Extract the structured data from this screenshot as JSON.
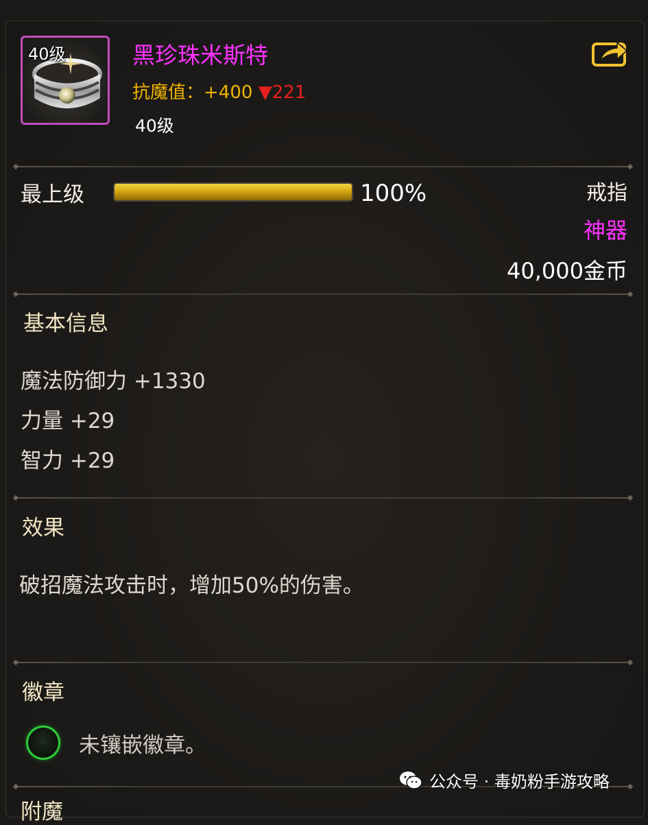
{
  "item": {
    "icon_level": "40级",
    "name": "黑珍珠米斯特",
    "anti_magic_label": "抗魔值：",
    "anti_magic_value": "+400",
    "anti_magic_diff": "▼221",
    "required_level": "40级"
  },
  "grade": {
    "label": "最上级",
    "percent_text": "100%",
    "fill_fraction": 1.0
  },
  "meta": {
    "type": "戒指",
    "rarity": "神器",
    "price": "40,000金币"
  },
  "basic_info": {
    "title": "基本信息",
    "stats": [
      "魔法防御力 +1330",
      "力量 +29",
      "智力 +29"
    ]
  },
  "effect": {
    "title": "效果",
    "text": "破招魔法攻击时，增加50%的伤害。"
  },
  "emblem": {
    "title": "徽章",
    "empty_text": "未镶嵌徽章。"
  },
  "enchant": {
    "title": "附魔"
  },
  "watermark": {
    "text": "公众号 · 毒奶粉手游攻略"
  },
  "colors": {
    "rarity_artifact": "#ff33ff",
    "anti_magic": "#f0b400",
    "decrease": "#e82020",
    "progress_gold": "#d4a812",
    "emblem_ring": "#2ecc38"
  },
  "icons": {
    "share": "share-export-icon",
    "item": "ring-item-icon",
    "emblem_slot": "empty-emblem-slot-icon",
    "watermark": "wechat-icon"
  }
}
